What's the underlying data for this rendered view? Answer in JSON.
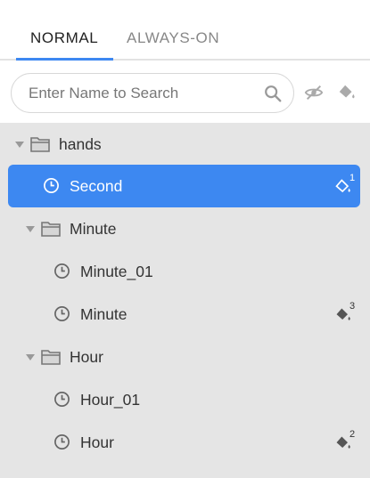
{
  "tabs": [
    {
      "label": "NORMAL",
      "active": true
    },
    {
      "label": "ALWAYS-ON",
      "active": false
    }
  ],
  "search": {
    "placeholder": "Enter Name to Search",
    "value": ""
  },
  "toolbar": {
    "hide_icon": "eye-off-icon",
    "paint_icon": "paint-bucket-icon"
  },
  "colors": {
    "accent": "#3d88f1",
    "tree_bg": "#e5e5e5",
    "text": "#333333",
    "icon": "#777777"
  },
  "tree": {
    "nodes": [
      {
        "type": "folder",
        "label": "hands",
        "expanded": true,
        "level": 0
      },
      {
        "type": "item",
        "label": "Second",
        "selected": true,
        "level": 1,
        "badge": "1"
      },
      {
        "type": "folder",
        "label": "Minute",
        "expanded": true,
        "level": 1
      },
      {
        "type": "item",
        "label": "Minute_01",
        "level": 2
      },
      {
        "type": "item",
        "label": "Minute",
        "level": 2,
        "badge": "3"
      },
      {
        "type": "folder",
        "label": "Hour",
        "expanded": true,
        "level": 1
      },
      {
        "type": "item",
        "label": "Hour_01",
        "level": 2
      },
      {
        "type": "item",
        "label": "Hour",
        "level": 2,
        "badge": "2"
      }
    ]
  }
}
